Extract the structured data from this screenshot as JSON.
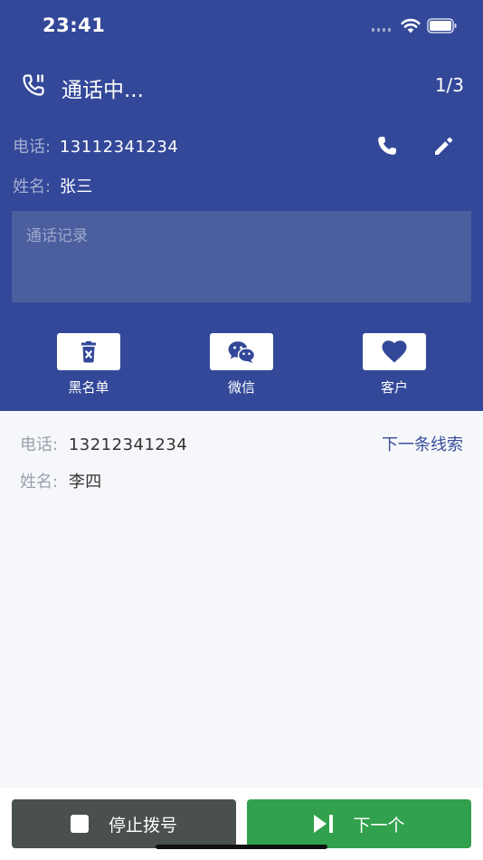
{
  "status": {
    "time": "23:41"
  },
  "header": {
    "title": "通话中...",
    "counter": "1/3"
  },
  "current": {
    "phone_label": "电话:",
    "phone": "13112341234",
    "name_label": "姓名:",
    "name": "张三",
    "notes_placeholder": "通话记录"
  },
  "actions": [
    {
      "label": "黑名单",
      "icon": "delete-icon"
    },
    {
      "label": "微信",
      "icon": "wechat-icon"
    },
    {
      "label": "客户",
      "icon": "heart-icon"
    }
  ],
  "next_card": {
    "phone_label": "电话:",
    "phone": "13212341234",
    "name_label": "姓名:",
    "name": "李四",
    "next_lead": "下一条线索"
  },
  "bottom": {
    "stop_label": "停止拨号",
    "next_label": "下一个"
  },
  "colors": {
    "primary": "#334899",
    "stop": "#4a4f4f",
    "next": "#31a14d"
  }
}
